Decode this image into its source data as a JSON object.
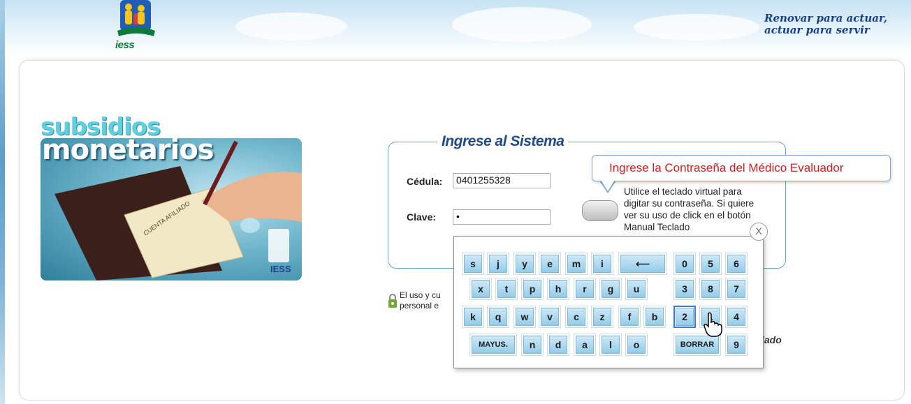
{
  "header": {
    "logo_text": "iess",
    "slogan_line1": "Renovar para actuar,",
    "slogan_line2": "actuar para servir"
  },
  "banner": {
    "title_line1": "subsidios",
    "title_line2": "monetarios",
    "card_text": "CUENTA AFILIADO",
    "badge_text": "IESS"
  },
  "login": {
    "legend": "Ingrese al Sistema",
    "cedula_label": "Cédula:",
    "cedula_value": "0401255328",
    "clave_label": "Clave:",
    "clave_value": "•",
    "callout": "Ingrese la Contraseña del Médico Evaluador",
    "help_text": "Utilice el teclado virtual para digitar su contraseña. Si quiere ver su uso de click en el botón Manual Teclado",
    "lock_note_line1": "El uso y cu",
    "lock_note_line2": "personal e",
    "manual_link": "lado"
  },
  "keyboard": {
    "close_label": "X",
    "rows": [
      [
        "s",
        "j",
        "y",
        "e",
        "m",
        "i"
      ],
      [
        "x",
        "t",
        "p",
        "h",
        "r",
        "g",
        "u"
      ],
      [
        "k",
        "q",
        "w",
        "v",
        "c",
        "z",
        "f",
        "b"
      ],
      [
        "n",
        "d",
        "a",
        "l",
        "o"
      ]
    ],
    "backspace_symbol": "⟵",
    "mayus_label": "MAYUS.",
    "borrar_label": "BORRAR",
    "numbers": [
      [
        "0",
        "5",
        "6"
      ],
      [
        "3",
        "8",
        "7"
      ],
      [
        "2",
        "1",
        "4"
      ],
      [
        "9"
      ]
    ]
  },
  "colors": {
    "accent_blue": "#1f4a8c",
    "callout_red": "#d51c1c",
    "key_blue": "#94cbe8"
  }
}
